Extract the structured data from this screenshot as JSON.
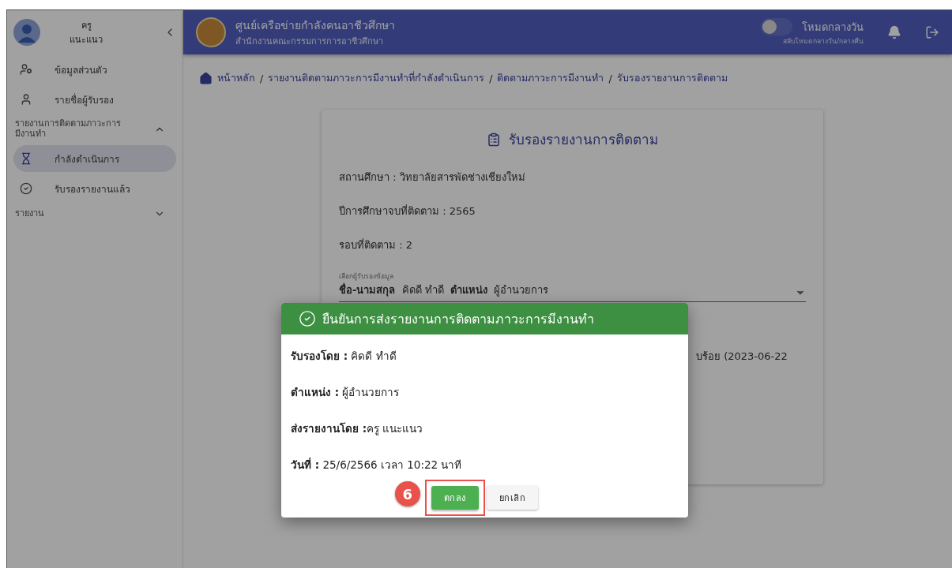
{
  "sidebar": {
    "user": {
      "first_name": "ครู",
      "last_name": "แนะแนว"
    },
    "items": [
      {
        "kind": "link",
        "label": "ข้อมูลส่วนตัว",
        "selected": false
      },
      {
        "kind": "link",
        "label": "รายชื่อผู้รับรอง",
        "selected": false
      },
      {
        "kind": "group",
        "label": "รายงานการติดตามภาวะการมีงานทำ",
        "expanded": true,
        "children": [
          {
            "kind": "link",
            "label": "กำลังดำเนินการ",
            "selected": true
          },
          {
            "kind": "link",
            "label": "รับรองรายงานแล้ว",
            "selected": false
          }
        ]
      },
      {
        "kind": "group",
        "label": "รายงาน",
        "expanded": false
      }
    ]
  },
  "header": {
    "title": "ศูนย์เครือข่ายกำลังคนอาชีวศึกษา",
    "subtitle": "สำนักงานคณะกรรมการการอาชีวศึกษา",
    "mode_switch": {
      "on": false,
      "label": "โหมดกลางวัน",
      "hint": "สลับโหมดกลางวัน/กลางคืน"
    }
  },
  "breadcrumb": {
    "separator": "/",
    "items": [
      "หน้าหลัก",
      "รายงานติดตามภาวะการมีงานทำที่กำลังดำเนินการ",
      "ติดตามภาวะการมีงานทำ",
      "รับรองรายงานการติดตาม"
    ]
  },
  "card": {
    "title": "รับรองรายงานการติดตาม",
    "rows": [
      "สถานศึกษา : วิทยาลัยสารพัดช่างเชียงใหม่",
      "ปีการศึกษาจบที่ติดตาม : 2565",
      "รอบที่ติดตาม : 2"
    ],
    "select": {
      "label": "เลือกผู้รับรองข้อมูล",
      "value": "**ชื่อ-นามสกุล**  คิดดี ทำดี  **ตำแหน่ง**  ผู้อำนวยการ"
    },
    "status_fragment": "บร้อย (2023-06-22"
  },
  "dialog": {
    "title": "ยืนยันการส่งรายงานการติดตามภาวะการมีงานทำ",
    "rows": [
      "**รับรองโดย :** คิดดี ทำดี",
      "**ตำแหน่ง :** ผู้อำนวยการ",
      "**ส่งรายงานโดย :**ครู แนะแนว",
      "**วันที่ :** 25/6/2566 เวลา 10:22 นาที"
    ],
    "buttons": [
      {
        "kind": "primary",
        "label": "ตกลง",
        "highlighted": true,
        "step": "6"
      },
      {
        "kind": "secondary",
        "label": "ยกเลิก",
        "highlighted": false
      }
    ]
  }
}
